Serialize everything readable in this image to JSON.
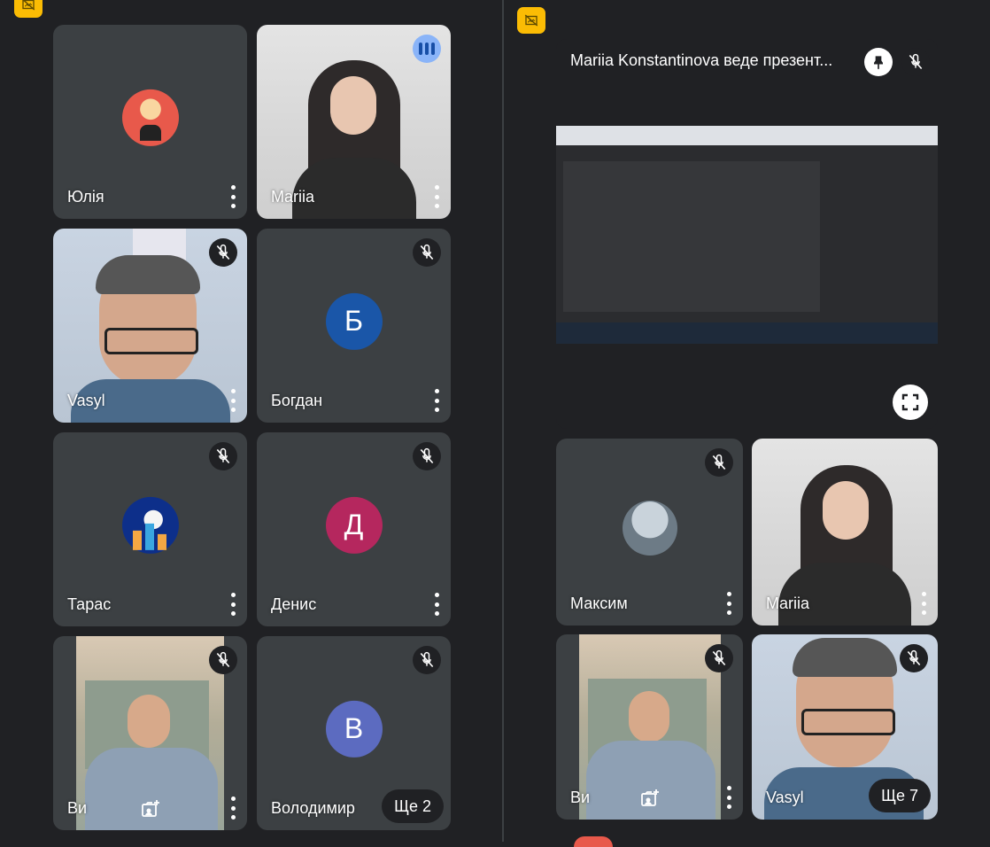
{
  "left_panel": {
    "tiles": [
      {
        "name": "Юлія",
        "avatar_color": "#e8594b"
      },
      {
        "name": "Mariia"
      },
      {
        "name": "Vasyl"
      },
      {
        "name": "Богдан",
        "initial": "Б",
        "avatar_color": "#1a56a8"
      },
      {
        "name": "Тарас",
        "avatar_color": "#0d2f8a"
      },
      {
        "name": "Денис",
        "initial": "Д",
        "avatar_color": "#b5275e"
      },
      {
        "name": "Ви"
      },
      {
        "name": "Володимир",
        "initial": "В",
        "avatar_color": "#5c6bc0",
        "more_label": "Ще 2"
      }
    ]
  },
  "right_panel": {
    "presentation": {
      "title": "Mariia Konstantinova веде презент..."
    },
    "tiles": [
      {
        "name": "Максим"
      },
      {
        "name": "Mariia"
      },
      {
        "name": "Ви"
      },
      {
        "name": "Vasyl",
        "more_label": "Ще 7"
      }
    ]
  },
  "icons": {
    "mic_off": "mic-off-icon",
    "menu": "more-vert-icon",
    "pin": "pin-icon",
    "fullscreen": "fullscreen-icon",
    "badge": "no-adjust-icon"
  },
  "colors": {
    "background": "#202124",
    "tile": "#3c4043",
    "badge": "#fbbc04",
    "speaking": "#8ab4f8"
  }
}
